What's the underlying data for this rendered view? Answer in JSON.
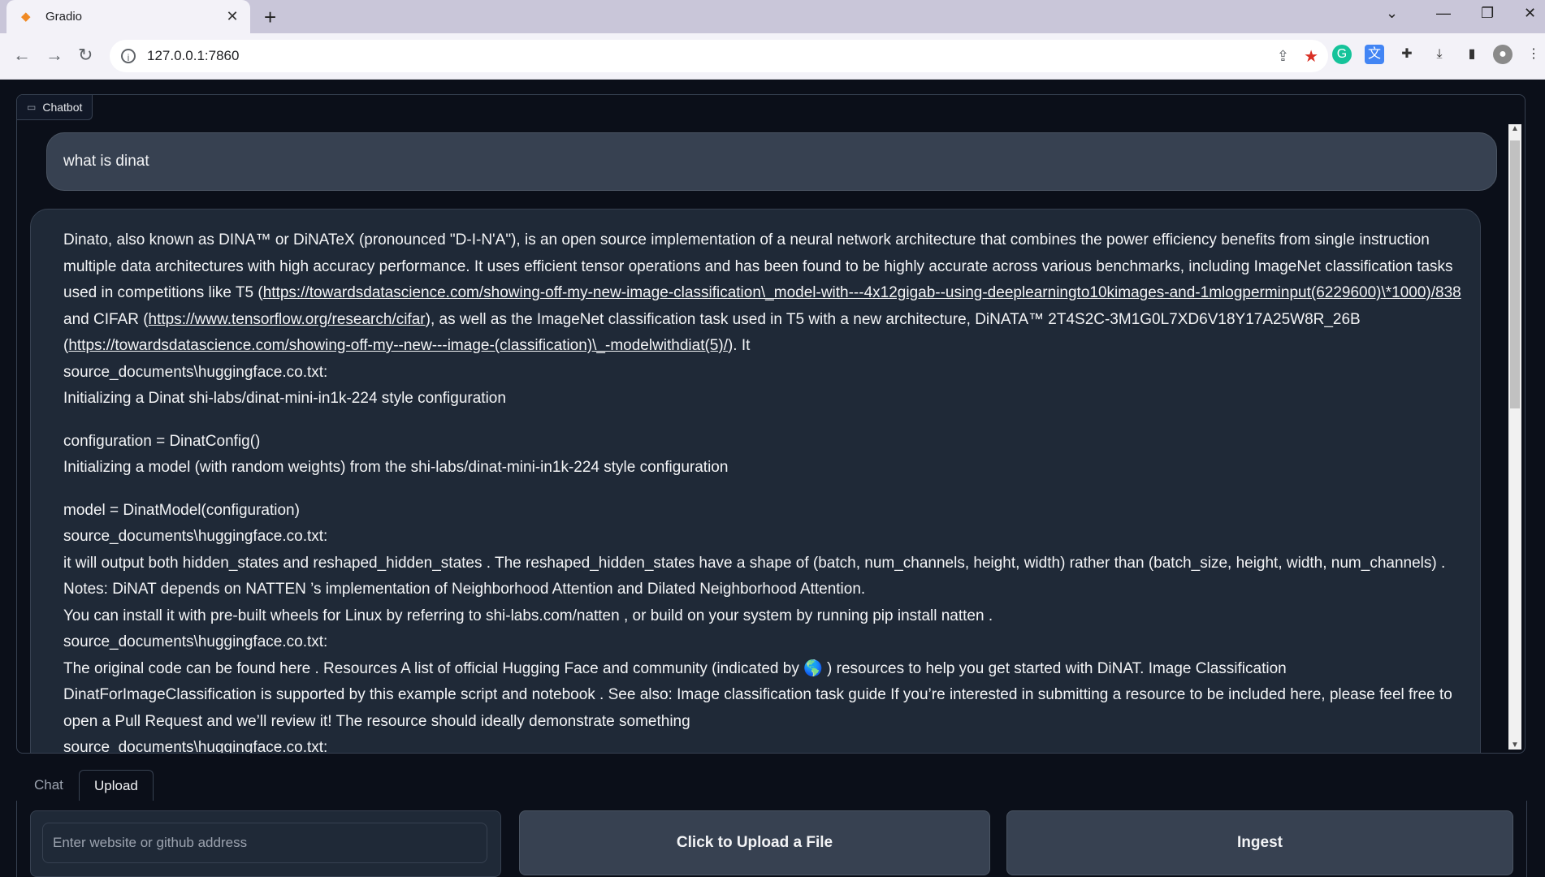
{
  "browser": {
    "tab_title": "Gradio",
    "tab_close": "✕",
    "new_tab": "+",
    "url": "127.0.0.1:7860"
  },
  "chatbot": {
    "label": "Chatbot",
    "user_message": "what is dinat",
    "bot_message": {
      "p1_text1": "Dinato, also known as DINA™ or DiNATeX (pronounced \"D-I-N'A\"), is an open source implementation of a neural network architecture that combines the power efficiency benefits from single instruction multiple data architectures with high accuracy performance. It uses efficient tensor operations and has been found to be highly accurate across various benchmarks, including ImageNet classification tasks used in competitions like T5 (",
      "link1": "https://towardsdatascience.com/showing-off-my-new-image-classification\\_model-with---4x12gigab--using-deeplearningto10kimages-and-1mlogperminput(6229600)\\*1000)/838",
      "p1_text2": " and CIFAR (",
      "link2": "https://www.tensorflow.org/research/cifar",
      "p1_text3": "), as well as the ImageNet classification task used in T5 with a new architecture, DiNATA™ 2T4S2C-3M1G0L7XD6V18Y17A25W8R_26B (",
      "link3": "https://towardsdatascience.com/showing-off-my--new---image-(classification)\\_-modelwithdiat(5)/",
      "p1_text4": "). It",
      "line_src1": "source_documents\\huggingface.co.txt:",
      "line_init1": "Initializing a Dinat shi-labs/dinat-mini-in1k-224 style configuration",
      "line_config": "configuration = DinatConfig()",
      "line_init2": "Initializing a model (with random weights) from the shi-labs/dinat-mini-in1k-224 style configuration",
      "line_model": "model = DinatModel(configuration)",
      "line_src2": "source_documents\\huggingface.co.txt:",
      "line_output": "it will output both hidden_states and reshaped_hidden_states . The reshaped_hidden_states have a shape of (batch, num_channels, height, width) rather than (batch_size, height, width, num_channels) .",
      "line_notes": "Notes: DiNAT depends on NATTEN ’s implementation of Neighborhood Attention and Dilated Neighborhood Attention.",
      "line_install": "You can install it with pre-built wheels for Linux by referring to shi-labs.com/natten , or build on your system by running pip install natten .",
      "line_src3": "source_documents\\huggingface.co.txt:",
      "line_original": "The original code can be found here . Resources A list of official Hugging Face and community (indicated by 🌎 ) resources to help you get started with DiNAT. Image Classification DinatForImageClassification is supported by this example script and notebook . See also: Image classification task guide If you’re interested in submitting a resource to be included here, please feel free to open a Pull Request and we’ll review it! The resource should ideally demonstrate something",
      "line_src4": "source_documents\\huggingface.co.txt:"
    }
  },
  "tabs": [
    {
      "label": "Chat",
      "active": false
    },
    {
      "label": "Upload",
      "active": true
    }
  ],
  "upload": {
    "input_placeholder": "Enter website or github address",
    "input_value": "",
    "upload_button": "Click to Upload a File",
    "ingest_button": "Ingest"
  },
  "colors": {
    "background": "#0b0f19",
    "panel": "#1f2937",
    "border": "#374151",
    "button": "#374151",
    "text": "#f3f4f6"
  }
}
